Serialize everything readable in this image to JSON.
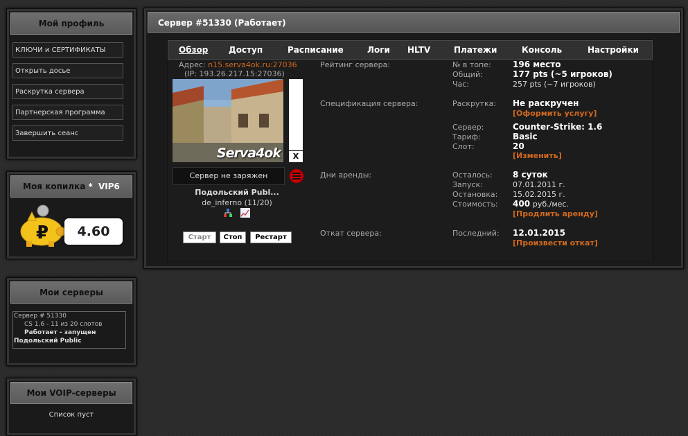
{
  "profile": {
    "title": "Мой профиль",
    "menu": [
      "КЛЮЧИ и СЕРТИФИКАТЫ",
      "Открыть досье",
      "Раскрутка сервера",
      "Партнерская программа",
      "Завершить сеанс"
    ]
  },
  "piggy": {
    "title": "Моя копилка",
    "star": "*",
    "vip": "VIP6",
    "currency_symbol": "₽",
    "balance": "4.60"
  },
  "my_servers": {
    "title": "Мои серверы",
    "line1": "Сервер # 51330",
    "line2": "CS 1.6 - 11 из 20 слотов",
    "line3": "Работает - запущен",
    "line4": "Подольский Public"
  },
  "voip": {
    "title": "Мои VOIP-серверы",
    "empty": "Список пуст"
  },
  "main": {
    "title": "Сервер #51330 (Работает)",
    "tabs": [
      "Обзор",
      "Доступ",
      "Расписание",
      "Логи",
      "HLTV",
      "Платежи",
      "Консоль",
      "Настройки"
    ],
    "address_label": "Адрес:",
    "address": "n15.serva4ok.ru:27036",
    "ip": "(IP: 193.26.217.15:27036)",
    "map_logo": "Serva4ok",
    "close_x": "X",
    "charge_status": "Сервер не заряжен",
    "server_name": "Подольский Publ...",
    "map_players": "de_inferno (11/20)",
    "buttons": [
      "Старт",
      "Стоп",
      "Рестарт"
    ],
    "rating": {
      "label": "Рейтинг сервера:",
      "top_label": "№ в топе:",
      "top_value": "196 место",
      "total_label": "Общий:",
      "total_value": "177 pts (~5 игроков)",
      "hour_label": "Час:",
      "hour_value": "257 pts (~7 игроков)"
    },
    "spec": {
      "label": "Спецификация сервера:",
      "promo_label": "Раскрутка:",
      "promo_value": "Не раскручен",
      "promo_link": "[Оформить услугу]",
      "server_label": "Сервер:",
      "server_value": "Counter-Strike: 1.6",
      "tariff_label": "Тариф:",
      "tariff_value": "Basic",
      "slot_label": "Слот:",
      "slot_value": "20",
      "slot_link": "[Изменить]"
    },
    "rent": {
      "label": "Дни аренды:",
      "left_label": "Осталось:",
      "left_value": "8 суток",
      "start_label": "Запуск:",
      "start_value": "07.01.2011 г.",
      "stop_label": "Остановка:",
      "stop_value": "15.02.2015 г.",
      "cost_label": "Стоимость:",
      "cost_value": "400",
      "cost_unit": "руб./мес.",
      "extend_link": "[Продлить аренду]"
    },
    "rollback": {
      "label": "Откат сервера:",
      "last_label": "Последний:",
      "last_value": "12.01.2015",
      "link": "[Произвести откат]"
    }
  }
}
